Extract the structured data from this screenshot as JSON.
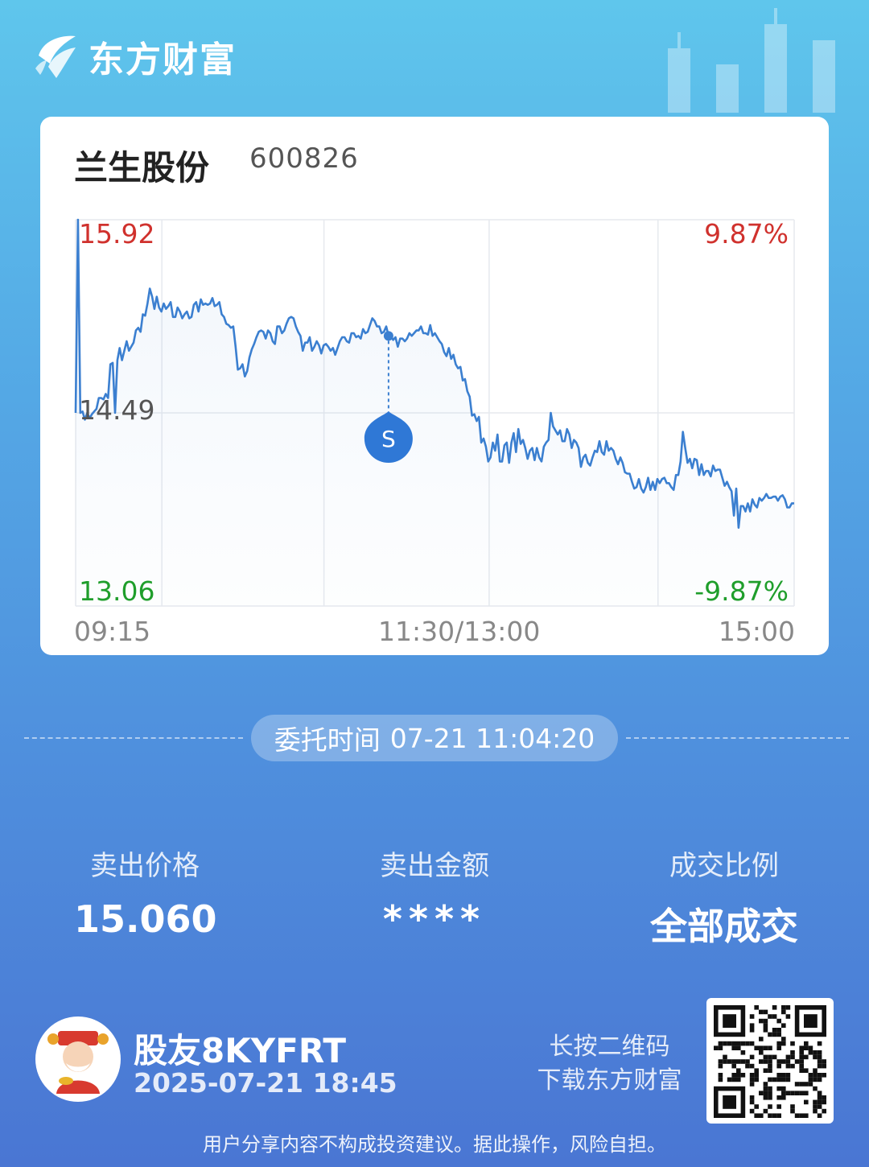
{
  "app": {
    "brand": "东方财富",
    "logo_icon": "eastmoney-logo-icon"
  },
  "stock": {
    "name": "兰生股份",
    "code": "600826"
  },
  "chart_data": {
    "type": "line",
    "price_high": "15.92",
    "price_base": "14.49",
    "price_low": "13.06",
    "pct_high": "9.87%",
    "pct_low": "-9.87%",
    "x_labels": {
      "start": "09:15",
      "mid": "11:30/13:00",
      "end": "15:00"
    },
    "ylim": [
      13.06,
      15.92
    ],
    "line_color": "#3b7fd0",
    "up_color": "#d0312d",
    "down_color": "#1f9e2b",
    "marker": {
      "label": "S",
      "time_index": 135,
      "price": 15.06
    },
    "series": [
      {
        "values": [
          14.49,
          15.92,
          14.49,
          14.5,
          14.44,
          14.49,
          14.45,
          14.48,
          14.5,
          14.52,
          14.6,
          14.6,
          14.59,
          14.63,
          14.6,
          14.85,
          14.86,
          14.49,
          14.88,
          14.97,
          14.88,
          14.95,
          15.02,
          14.95,
          14.98,
          15.01,
          15.1,
          15.12,
          15.09,
          15.22,
          15.21,
          15.3,
          15.41,
          15.35,
          15.26,
          15.35,
          15.27,
          15.24,
          15.3,
          15.26,
          15.28,
          15.31,
          15.2,
          15.2,
          15.27,
          15.24,
          15.19,
          15.22,
          15.24,
          15.19,
          15.2,
          15.29,
          15.31,
          15.24,
          15.33,
          15.29,
          15.3,
          15.29,
          15.3,
          15.34,
          15.28,
          15.29,
          15.31,
          15.22,
          15.2,
          15.15,
          15.14,
          15.12,
          15.13,
          14.98,
          14.81,
          14.82,
          14.85,
          14.76,
          14.8,
          14.9,
          14.96,
          15.0,
          15.05,
          15.09,
          15.1,
          15.09,
          15.04,
          15.1,
          15.08,
          15.02,
          15.0,
          15.13,
          15.13,
          15.08,
          15.1,
          15.15,
          15.19,
          15.2,
          15.19,
          15.13,
          15.09,
          15.06,
          14.95,
          15.01,
          15.01,
          15.05,
          14.95,
          14.98,
          15.02,
          14.99,
          14.93,
          14.99,
          15.0,
          14.98,
          14.95,
          14.97,
          14.92,
          14.97,
          15.02,
          15.05,
          15.05,
          15.02,
          15.01,
          15.08,
          15.08,
          15.05,
          15.06,
          15.04,
          15.11,
          15.08,
          15.09,
          15.14,
          15.19,
          15.17,
          15.13,
          15.13,
          15.08,
          15.09,
          15.13,
          15.06,
          15.06,
          15.03,
          15.05,
          14.98,
          15.04,
          15.04,
          15.02,
          15.04,
          15.08,
          15.06,
          15.08,
          15.1,
          15.1,
          15.13,
          15.08,
          15.08,
          15.07,
          15.14,
          15.06,
          15.08,
          15.05,
          15.02,
          15.0,
          14.94,
          14.91,
          14.97,
          14.89,
          14.92,
          14.85,
          14.82,
          14.83,
          14.73,
          14.74,
          14.65,
          14.61,
          14.47,
          14.48,
          14.43,
          14.46,
          14.27,
          14.3,
          14.24,
          14.13,
          14.16,
          14.27,
          14.21,
          14.33,
          14.13,
          14.13,
          14.25,
          14.27,
          14.12,
          14.27,
          14.34,
          14.2,
          14.37,
          14.26,
          14.29,
          14.23,
          14.15,
          14.21,
          14.23,
          14.14,
          14.23,
          14.16,
          14.13,
          14.24,
          14.27,
          14.29,
          14.49,
          14.39,
          14.36,
          14.33,
          14.36,
          14.28,
          14.28,
          14.37,
          14.33,
          14.23,
          14.29,
          14.27,
          14.23,
          14.09,
          14.16,
          14.18,
          14.12,
          14.1,
          14.16,
          14.21,
          14.2,
          14.28,
          14.2,
          14.18,
          14.28,
          14.21,
          14.23,
          14.21,
          14.15,
          14.11,
          14.16,
          14.12,
          14.05,
          14.04,
          14.04,
          13.98,
          13.93,
          13.94,
          14.0,
          13.93,
          13.9,
          13.94,
          14.01,
          13.92,
          13.98,
          13.92,
          14.0,
          13.97,
          14.0,
          14.01,
          13.97,
          13.97,
          13.94,
          13.92,
          14.03,
          14.03,
          14.13,
          14.35,
          14.23,
          14.12,
          14.15,
          14.08,
          14.15,
          14.14,
          14.03,
          14.11,
          14.03,
          14.06,
          14.06,
          14.02,
          14.1,
          14.06,
          14.07,
          14.07,
          14.01,
          13.95,
          13.98,
          13.94,
          13.91,
          13.73,
          13.93,
          13.64,
          13.8,
          13.8,
          13.76,
          13.82,
          13.76,
          13.85,
          13.81,
          13.79,
          13.86,
          13.84,
          13.86,
          13.89,
          13.86,
          13.86,
          13.87,
          13.87,
          13.84,
          13.87,
          13.88,
          13.85,
          13.79,
          13.79,
          13.82,
          13.82
        ]
      }
    ]
  },
  "order": {
    "label": "委托时间",
    "time": "07-21 11:04:20"
  },
  "stats": [
    {
      "label": "卖出价格",
      "value": "15.060"
    },
    {
      "label": "卖出金额",
      "value": "****"
    },
    {
      "label": "成交比例",
      "value": "全部成交"
    }
  ],
  "user": {
    "name": "股友8KYFRT",
    "time": "2025-07-21 18:45",
    "avatar_icon": "caishen-avatar-icon"
  },
  "qr": {
    "hint_line1": "长按二维码",
    "hint_line2": "下载东方财富",
    "icon": "qr-code-icon"
  },
  "footer": {
    "disclaimer": "用户分享内容不构成投资建议。据此操作，风险自担。"
  }
}
